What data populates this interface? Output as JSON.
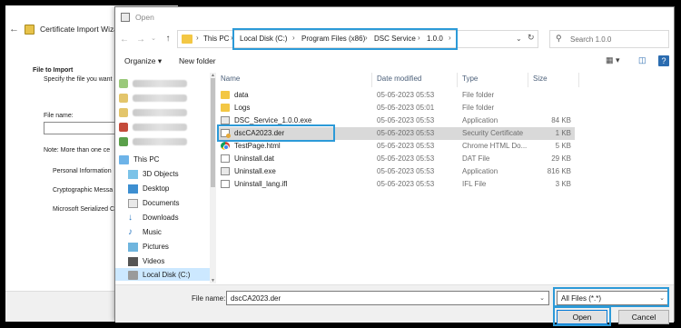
{
  "wizard": {
    "title": "Certificate Import Wizard",
    "section_title": "File to Import",
    "section_sub": "Specify the file you want",
    "file_name_label": "File name:",
    "note": "Note:  More than one ce",
    "formats": [
      "Personal Information",
      "Cryptographic Messa",
      "Microsoft Serialized C"
    ]
  },
  "dialog": {
    "title": "Open",
    "address": {
      "root": "This PC",
      "crumbs": [
        "Local Disk (C:)",
        "Program Files (x86)",
        "DSC Service",
        "1.0.0"
      ]
    },
    "search_placeholder": "Search 1.0.0",
    "toolbar": {
      "organize": "Organize ▾",
      "new_folder": "New folder"
    },
    "nav": {
      "this_pc": "This PC",
      "items": [
        "3D Objects",
        "Desktop",
        "Documents",
        "Downloads",
        "Music",
        "Pictures",
        "Videos",
        "Local Disk (C:)"
      ]
    },
    "columns": {
      "name": "Name",
      "date": "Date modified",
      "type": "Type",
      "size": "Size"
    },
    "files": [
      {
        "name": "data",
        "date": "05-05-2023 05:53",
        "type": "File folder",
        "size": ""
      },
      {
        "name": "Logs",
        "date": "05-05-2023 05:01",
        "type": "File folder",
        "size": ""
      },
      {
        "name": "DSC_Service_1.0.0.exe",
        "date": "05-05-2023 05:53",
        "type": "Application",
        "size": "84 KB"
      },
      {
        "name": "dscCA2023.der",
        "date": "05-05-2023 05:53",
        "type": "Security Certificate",
        "size": "1 KB"
      },
      {
        "name": "TestPage.html",
        "date": "05-05-2023 05:53",
        "type": "Chrome HTML Do...",
        "size": "5 KB"
      },
      {
        "name": "Uninstall.dat",
        "date": "05-05-2023 05:53",
        "type": "DAT File",
        "size": "29 KB"
      },
      {
        "name": "Uninstall.exe",
        "date": "05-05-2023 05:53",
        "type": "Application",
        "size": "816 KB"
      },
      {
        "name": "Uninstall_lang.ifl",
        "date": "05-05-2023 05:53",
        "type": "IFL File",
        "size": "3 KB"
      }
    ],
    "file_name_label": "File name:",
    "file_name_value": "dscCA2023.der",
    "file_type": "All Files (*.*)",
    "open_button": "Open",
    "cancel_button": "Cancel"
  },
  "colors": {
    "highlight": "#2c9ad8",
    "selection": "#cce8ff"
  }
}
